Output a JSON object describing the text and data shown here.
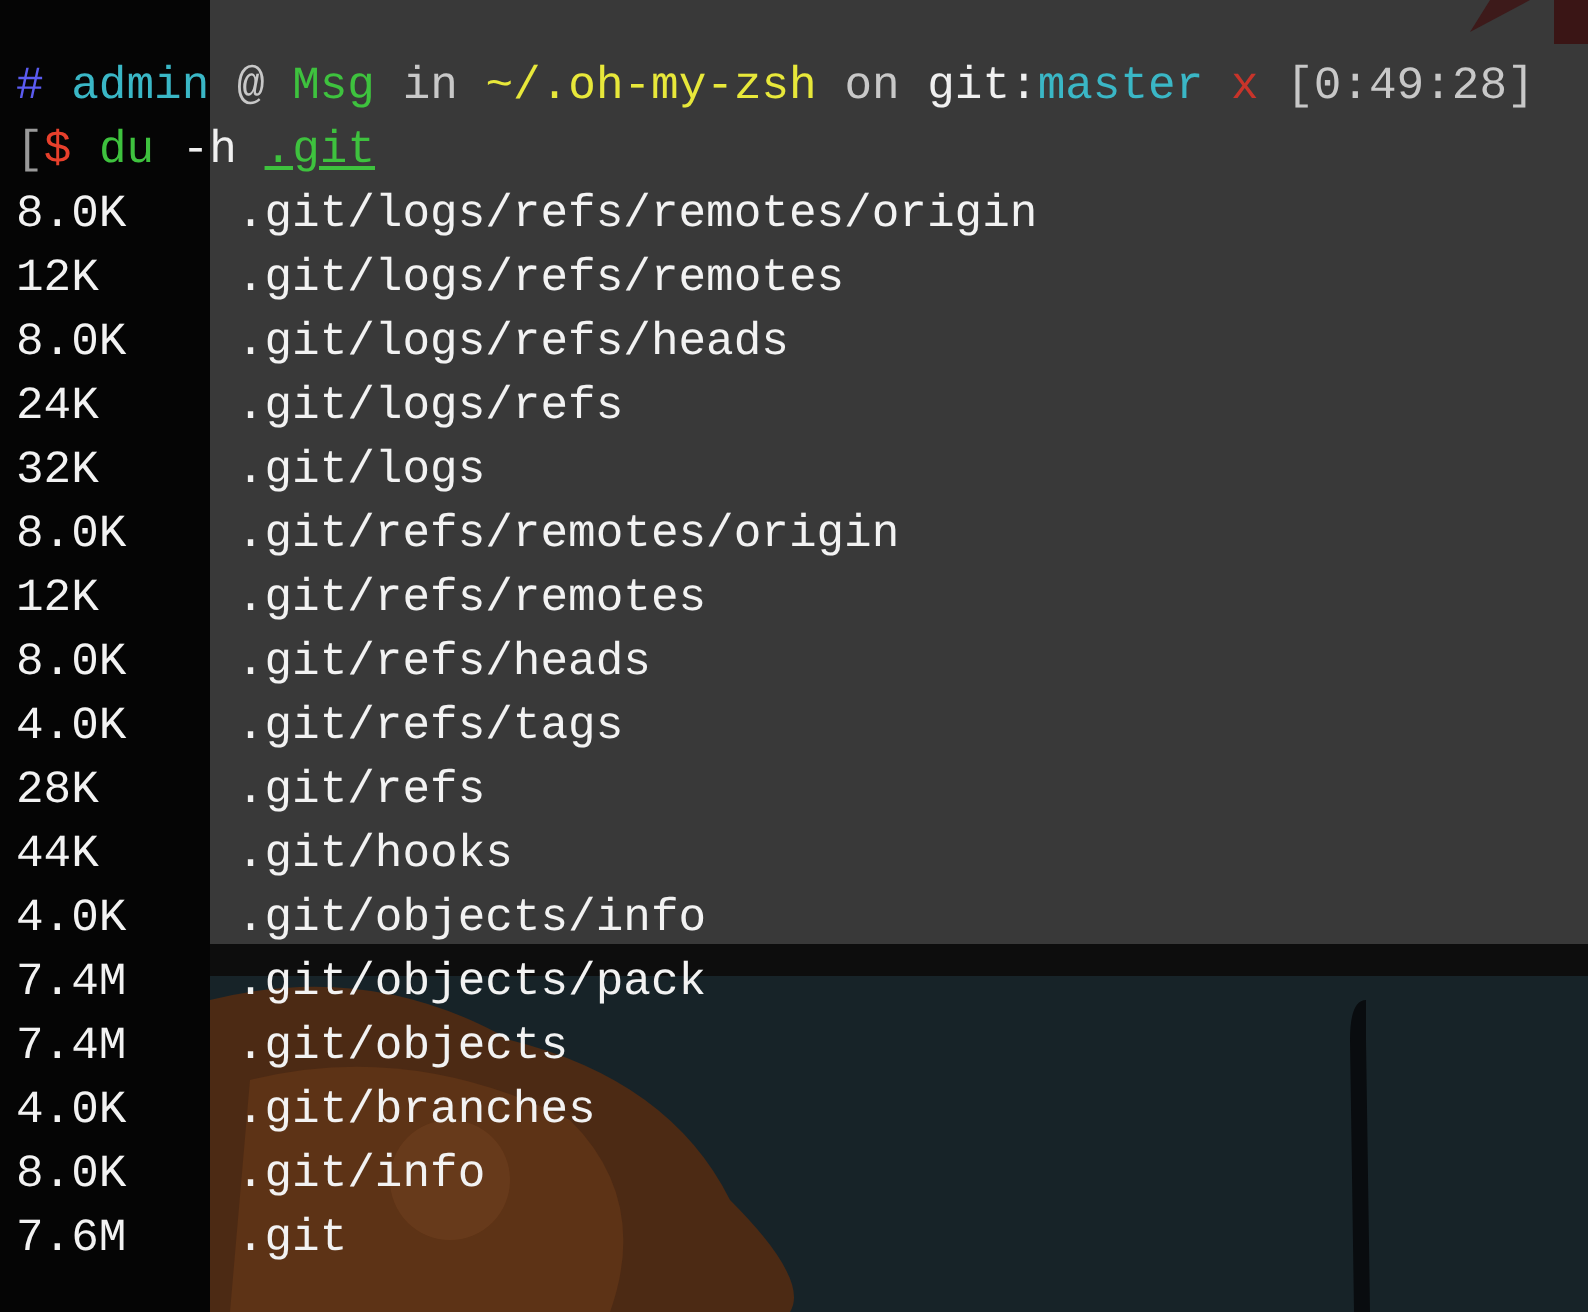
{
  "prompt": [
    {
      "text": "#",
      "color": "#5b5bf0"
    },
    {
      "text": "admin",
      "color": "#3ab7c6"
    },
    {
      "text": "@",
      "color": "#c8c8c8"
    },
    {
      "text": "Msg",
      "color": "#3ec23e"
    },
    {
      "text": "in",
      "color": "#c8c8c8"
    },
    {
      "text": "~/.oh-my-zsh",
      "color": "#e8e83a"
    },
    {
      "text": "on",
      "color": "#c8c8c8"
    },
    {
      "text": "git:",
      "color": "#f0f0f0",
      "join": true
    },
    {
      "text": "master",
      "color": "#3ab7c6"
    },
    {
      "text": "x",
      "color": "#c8342a"
    },
    {
      "text": "[0:49:28]",
      "color": "#c8c8c8"
    }
  ],
  "command": [
    {
      "text": "[",
      "color": "#9a9a9a",
      "join": true
    },
    {
      "text": "$",
      "color": "#e8402c"
    },
    {
      "text": "du",
      "color": "#3ec23e"
    },
    {
      "text": "-h",
      "color": "#f0f0f0"
    },
    {
      "text": ".git",
      "color": "#3ec23e",
      "underline": true
    }
  ],
  "rows": [
    {
      "size": "8.0K",
      "path": ".git/logs/refs/remotes/origin"
    },
    {
      "size": "12K",
      "path": ".git/logs/refs/remotes"
    },
    {
      "size": "8.0K",
      "path": ".git/logs/refs/heads"
    },
    {
      "size": "24K",
      "path": ".git/logs/refs"
    },
    {
      "size": "32K",
      "path": ".git/logs"
    },
    {
      "size": "8.0K",
      "path": ".git/refs/remotes/origin"
    },
    {
      "size": "12K",
      "path": ".git/refs/remotes"
    },
    {
      "size": "8.0K",
      "path": ".git/refs/heads"
    },
    {
      "size": "4.0K",
      "path": ".git/refs/tags"
    },
    {
      "size": "28K",
      "path": ".git/refs"
    },
    {
      "size": "44K",
      "path": ".git/hooks"
    },
    {
      "size": "4.0K",
      "path": ".git/objects/info"
    },
    {
      "size": "7.4M",
      "path": ".git/objects/pack"
    },
    {
      "size": "7.4M",
      "path": ".git/objects"
    },
    {
      "size": "4.0K",
      "path": ".git/branches"
    },
    {
      "size": "8.0K",
      "path": ".git/info"
    },
    {
      "size": "7.6M",
      "path": ".git"
    }
  ]
}
